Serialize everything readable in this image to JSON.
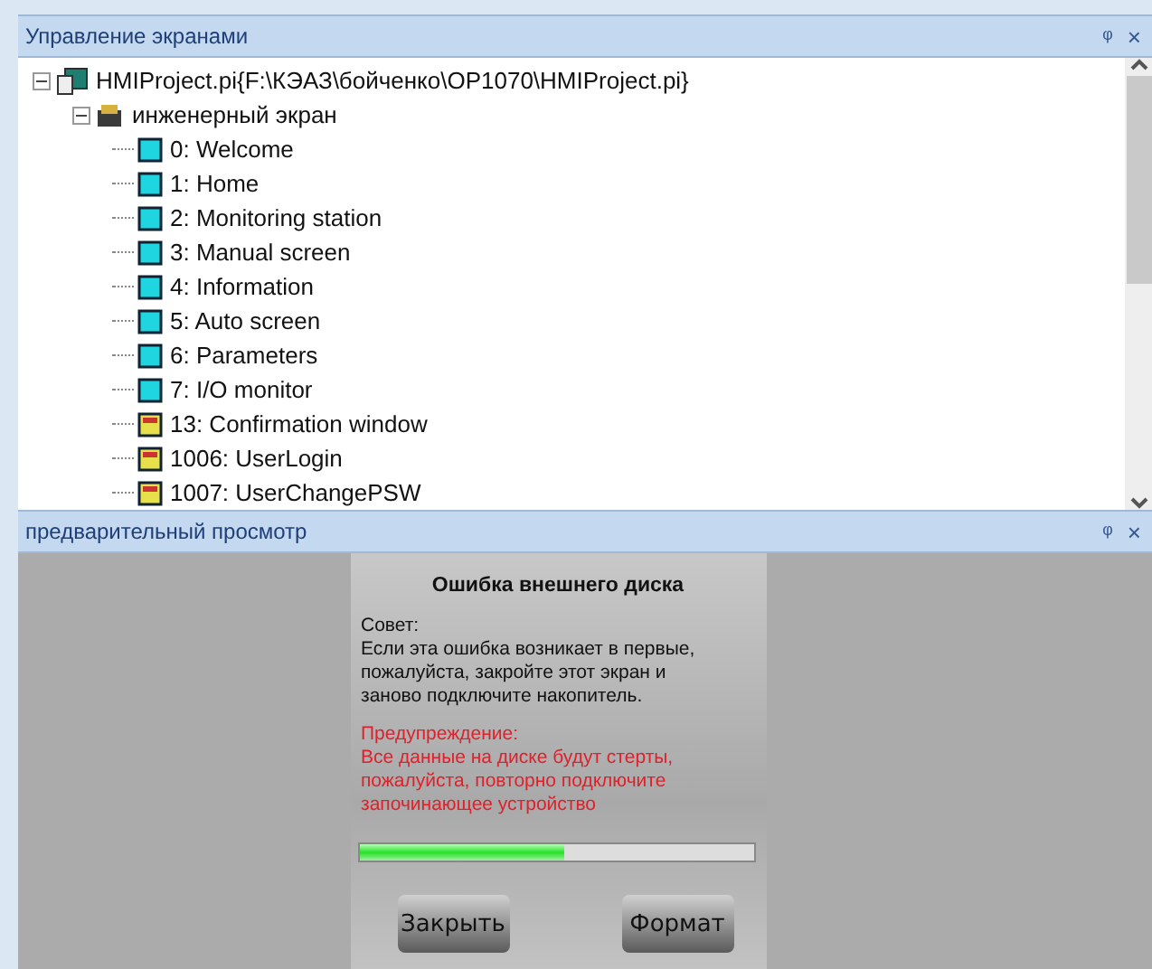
{
  "screen_panel": {
    "title": "Управление экранами",
    "pin": "ᵠ",
    "close": "×"
  },
  "tree": {
    "label": "HMIProject.pi{F:\\КЭАЗ\\бойченко\\OP1070\\HMIProject.pi}",
    "kind": "project",
    "expanded": true,
    "children": [
      {
        "label": "инженерный экран",
        "kind": "folder",
        "expanded": true,
        "children": [
          {
            "label": "0: Welcome",
            "kind": "screen"
          },
          {
            "label": "1: Home",
            "kind": "screen"
          },
          {
            "label": "2: Monitoring station",
            "kind": "screen"
          },
          {
            "label": "3: Manual screen",
            "kind": "screen"
          },
          {
            "label": "4: Information",
            "kind": "screen"
          },
          {
            "label": "5: Auto screen",
            "kind": "screen"
          },
          {
            "label": "6: Parameters",
            "kind": "screen"
          },
          {
            "label": "7: I/O monitor",
            "kind": "screen"
          },
          {
            "label": "13: Confirmation window",
            "kind": "window"
          },
          {
            "label": "1006: UserLogin",
            "kind": "window"
          },
          {
            "label": "1007: UserChangePSW",
            "kind": "window"
          }
        ]
      }
    ]
  },
  "preview_panel": {
    "title": "предварительный просмотр",
    "pin": "ᵠ",
    "close": "×"
  },
  "dialog": {
    "title": "Ошибка внешнего диска",
    "advice_label": "Совет:",
    "advice": "Если эта ошибка возникает в первые, пожалуйста, закройте этот экран и заново подключите накопитель.",
    "warning_label": "Предупреждение:",
    "warning": "Все данные на диске будут стерты, пожалуйста, повторно подключите започинающее устройство",
    "progress": {
      "level": 0.52
    },
    "buttons": [
      "Закрыть",
      "Формат"
    ]
  }
}
